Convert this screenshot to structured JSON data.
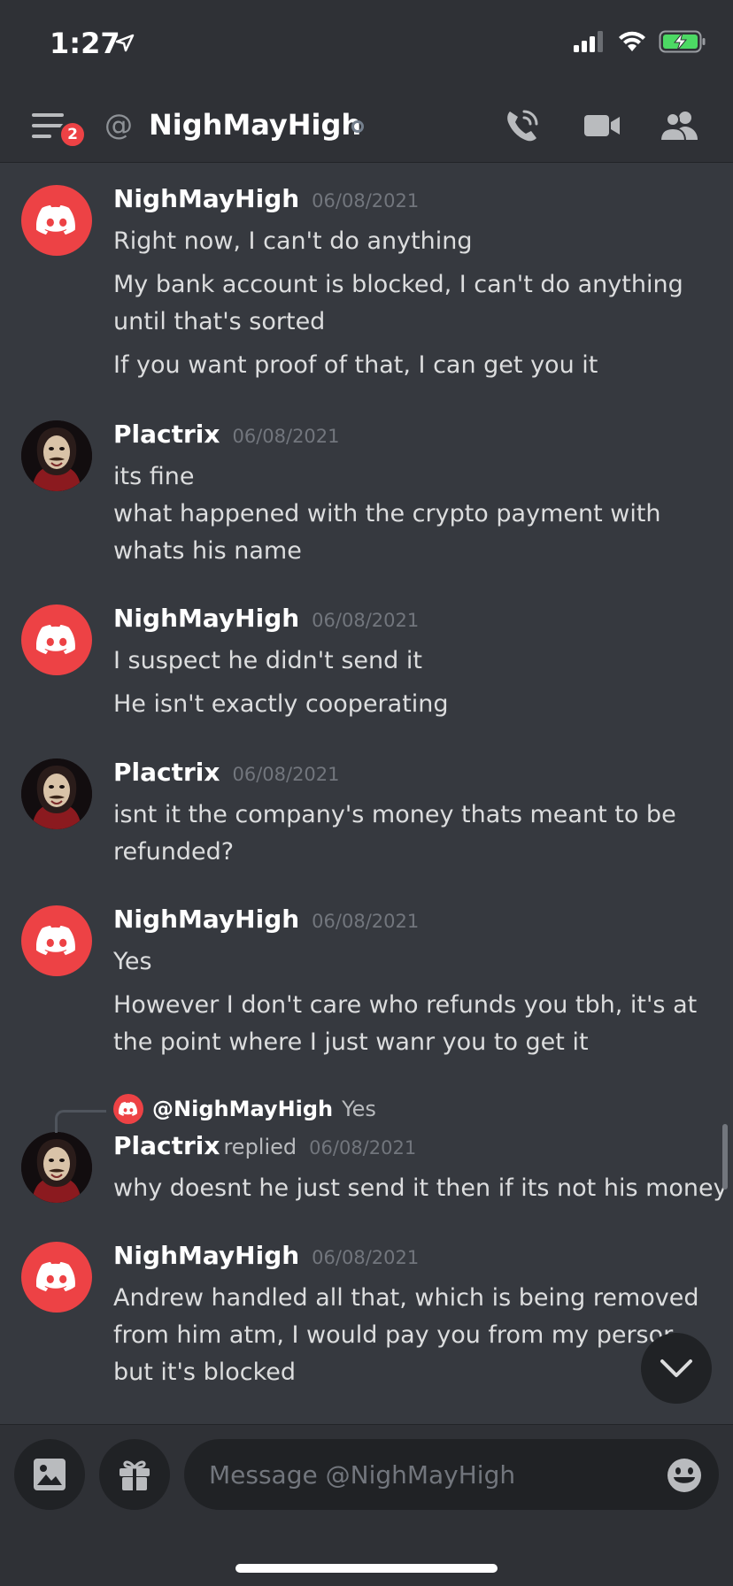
{
  "status_bar": {
    "time": "1:27"
  },
  "header": {
    "title": "NighMayHigh",
    "badge_count": "2"
  },
  "messages": [
    {
      "author": "NighMayHigh",
      "timestamp": "06/08/2021",
      "avatar": "discord-logo",
      "lines": [
        "Right now, I can't do anything",
        "My bank account is blocked, I can't do anything",
        "until that's sorted",
        "If you want proof of that, I can get you it"
      ]
    },
    {
      "author": "Plactrix",
      "timestamp": "06/08/2021",
      "avatar": "mask",
      "lines": [
        "its fine",
        "what happened with the crypto payment with",
        "whats his name"
      ]
    },
    {
      "author": "NighMayHigh",
      "timestamp": "06/08/2021",
      "avatar": "discord-logo",
      "lines": [
        "I suspect he didn't send it",
        "He isn't exactly cooperating"
      ]
    },
    {
      "author": "Plactrix",
      "timestamp": "06/08/2021",
      "avatar": "mask",
      "lines": [
        "isnt it the company's money thats meant to be",
        "refunded?"
      ]
    },
    {
      "author": "NighMayHigh",
      "timestamp": "06/08/2021",
      "avatar": "discord-logo",
      "lines": [
        "Yes",
        "However I don't care who refunds you tbh, it's at",
        "the point where I just wanr you to get it"
      ]
    },
    {
      "author": "Plactrix",
      "replied_label": "replied",
      "timestamp": "06/08/2021",
      "avatar": "mask",
      "reply_to": {
        "name": "@NighMayHigh",
        "text": "Yes"
      },
      "lines": [
        "why doesnt he just send it then if its not his money"
      ]
    },
    {
      "author": "NighMayHigh",
      "timestamp": "06/08/2021",
      "avatar": "discord-logo",
      "lines": [
        "Andrew handled all that, which is being removed",
        "from him atm, I would pay you from my persor",
        "but it's blocked"
      ]
    }
  ],
  "composer": {
    "placeholder": "Message @NighMayHigh"
  },
  "colors": {
    "accent": "#ed4245",
    "background": "#36393f",
    "header": "#2f3136",
    "input": "#202225"
  },
  "icons": [
    "location-arrow-icon",
    "signal-icon",
    "wifi-icon",
    "battery-charging-icon",
    "hamburger-menu-icon",
    "at-icon",
    "phone-call-icon",
    "video-camera-icon",
    "members-icon",
    "discord-logo-icon",
    "chevron-down-icon",
    "image-icon",
    "gift-icon",
    "emoji-icon"
  ]
}
